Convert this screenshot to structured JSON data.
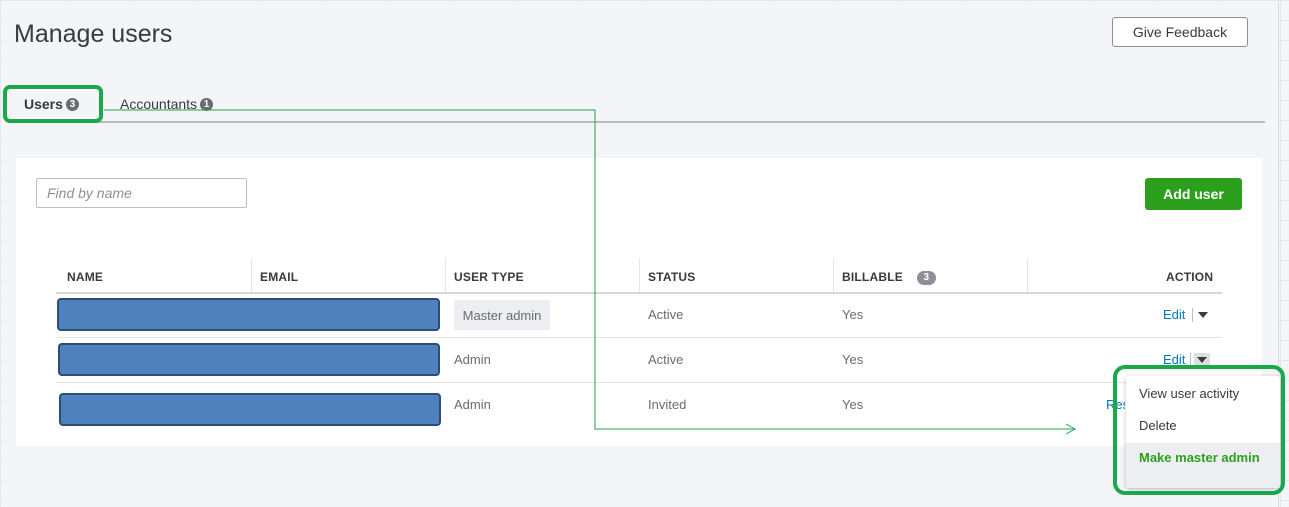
{
  "page": {
    "title": "Manage users",
    "feedback_label": "Give Feedback"
  },
  "tabs": [
    {
      "label": "Users",
      "count": "3",
      "active": true
    },
    {
      "label": "Accountants",
      "count": "1",
      "active": false
    }
  ],
  "toolbar": {
    "search_placeholder": "Find by name",
    "add_user_label": "Add user"
  },
  "table": {
    "headers": {
      "name": "NAME",
      "email": "EMAIL",
      "user_type": "USER TYPE",
      "status": "STATUS",
      "billable": "BILLABLE",
      "billable_count": "3",
      "action": "ACTION"
    },
    "rows": [
      {
        "user_type": "Master admin",
        "status": "Active",
        "billable": "Yes",
        "action": "Edit"
      },
      {
        "user_type": "Admin",
        "status": "Active",
        "billable": "Yes",
        "action": "Edit"
      },
      {
        "user_type": "Admin",
        "status": "Invited",
        "billable": "Yes",
        "action": "Res"
      }
    ]
  },
  "dropdown": {
    "items": [
      "View user activity",
      "Delete",
      "Make master admin"
    ],
    "highlighted_index": 2
  },
  "colors": {
    "brand_green": "#2ca01c",
    "annotation_green": "#19a84a",
    "link_blue": "#0077c5",
    "redaction_blue": "#4f81bd"
  }
}
